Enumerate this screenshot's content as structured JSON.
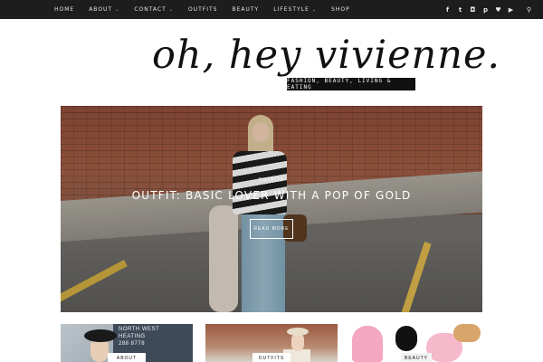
{
  "nav": {
    "items": [
      {
        "label": "HOME",
        "has_dropdown": false
      },
      {
        "label": "ABOUT",
        "has_dropdown": true
      },
      {
        "label": "CONTACT",
        "has_dropdown": true
      },
      {
        "label": "OUTFITS",
        "has_dropdown": false
      },
      {
        "label": "BEAUTY",
        "has_dropdown": false
      },
      {
        "label": "LIFESTYLE",
        "has_dropdown": true
      },
      {
        "label": "SHOP",
        "has_dropdown": false
      }
    ],
    "dropdown_glyph": "⌄"
  },
  "social": {
    "icons": [
      "facebook-icon",
      "twitter-icon",
      "instagram-icon",
      "pinterest-icon",
      "bloglovin-heart-icon",
      "youtube-icon",
      "search-icon"
    ],
    "glyphs": {
      "facebook": "f",
      "twitter": "t",
      "instagram": "◘",
      "pinterest": "p",
      "heart": "♥",
      "youtube": "▶",
      "search": "⚲"
    }
  },
  "logo": {
    "text": "oh, hey vivienne.",
    "tagline": "FASHION, BEAUTY, LIVING & EATING"
  },
  "featured": {
    "category": "OUTFITS",
    "title": "OUTFIT: BASIC LOVER WITH A POP OF GOLD",
    "button": "READ MORE"
  },
  "cards": [
    {
      "label": "ABOUT",
      "sign_text": "NORTH WEST\nHEATING\n288 8778"
    },
    {
      "label": "OUTFITS"
    },
    {
      "label": "BEAUTY"
    }
  ],
  "colors": {
    "topbar_bg": "#1d1d1d",
    "accent_text": "#ffffff",
    "ink": "#111111"
  }
}
